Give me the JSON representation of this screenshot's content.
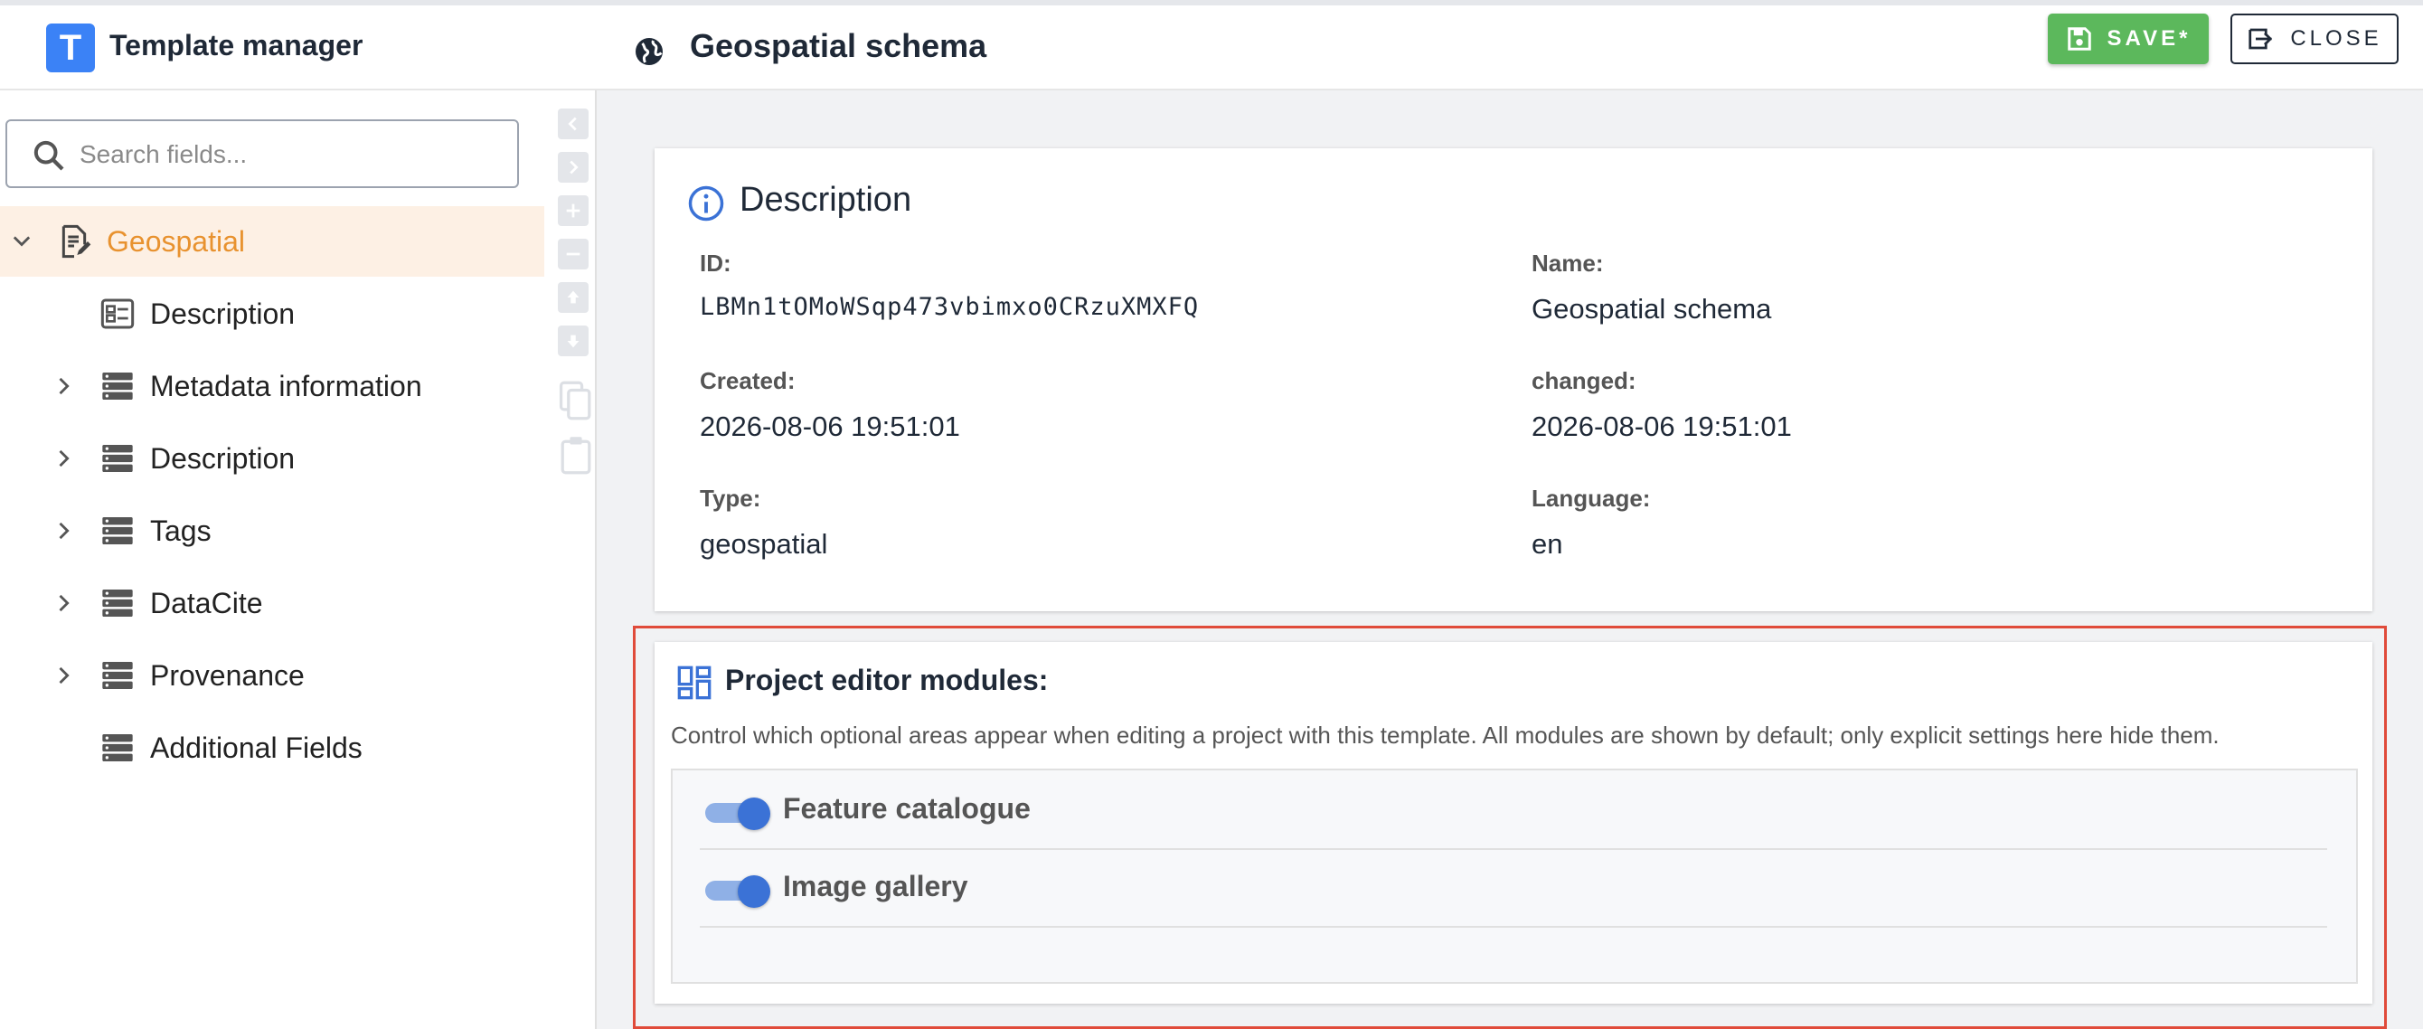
{
  "header": {
    "logo_letter": "T",
    "app_title": "Template manager",
    "page_title": "Geospatial schema",
    "save_label": "SAVE*",
    "close_label": "CLOSE"
  },
  "sidebar": {
    "search_placeholder": "Search fields...",
    "tree": [
      {
        "label": "Geospatial",
        "icon": "edit-document-icon",
        "expandable": true,
        "expanded": true,
        "selected": true
      },
      {
        "label": "Description",
        "icon": "form-icon",
        "expandable": false
      },
      {
        "label": "Metadata information",
        "icon": "stack-icon",
        "expandable": true
      },
      {
        "label": "Description",
        "icon": "stack-icon",
        "expandable": true
      },
      {
        "label": "Tags",
        "icon": "stack-icon",
        "expandable": true
      },
      {
        "label": "DataCite",
        "icon": "stack-icon",
        "expandable": true
      },
      {
        "label": "Provenance",
        "icon": "stack-icon",
        "expandable": true
      },
      {
        "label": "Additional Fields",
        "icon": "stack-icon",
        "expandable": false
      }
    ]
  },
  "description": {
    "title": "Description",
    "id_label": "ID:",
    "id_value": "LBMn1tOMoWSqp473vbimxo0CRzuXMXFQ",
    "name_label": "Name:",
    "name_value": "Geospatial schema",
    "created_label": "Created:",
    "created_value": "2026-08-06 19:51:01",
    "changed_label": "changed:",
    "changed_value": "2026-08-06 19:51:01",
    "type_label": "Type:",
    "type_value": "geospatial",
    "language_label": "Language:",
    "language_value": "en"
  },
  "modules": {
    "title": "Project editor modules:",
    "description": "Control which optional areas appear when editing a project with this template. All modules are shown by default; only explicit settings here hide them.",
    "toggles": [
      {
        "label": "Feature catalogue",
        "on": true
      },
      {
        "label": "Image gallery",
        "on": true
      }
    ]
  },
  "colors": {
    "accent": "#3b82f6",
    "save_green": "#5cb85c",
    "selected_bg": "#fdf0e4",
    "selected_text": "#e8922f",
    "highlight_border": "#e04b3a",
    "toggle_blue": "#3b72d6"
  }
}
